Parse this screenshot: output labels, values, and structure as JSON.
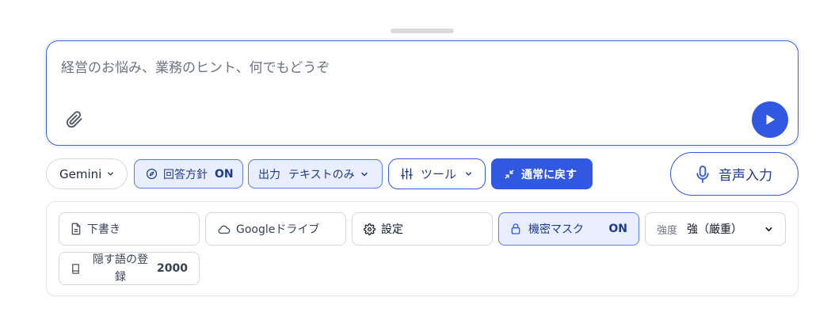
{
  "composer": {
    "placeholder": "経営のお悩み、業務のヒント、何でもどうぞ"
  },
  "chips": {
    "model": "Gemini",
    "policy_label": "回答方針",
    "policy_state": "ON",
    "output_label": "出力",
    "output_value": "テキストのみ",
    "tools_label": "ツール",
    "normal_label": "通常に戻す"
  },
  "voice": {
    "label": "音声入力"
  },
  "options": {
    "draft": "下書き",
    "drive": "Googleドライブ",
    "settings": "設定",
    "mask_label": "機密マスク",
    "mask_state": "ON",
    "strength_label": "強度",
    "strength_value": "強（厳重）",
    "dict_label_line1": "隠す語の登",
    "dict_label_line2": "録",
    "dict_count": "2000"
  },
  "colors": {
    "accent": "#3158e0",
    "accent_light": "#e9eefc",
    "border": "#d5d7db"
  },
  "icons": [
    "paperclip-icon",
    "play-icon",
    "chevron-down-icon",
    "compass-icon",
    "sliders-icon",
    "shrink-icon",
    "microphone-icon",
    "document-icon",
    "cloud-icon",
    "gear-icon",
    "lock-icon",
    "book-icon"
  ]
}
